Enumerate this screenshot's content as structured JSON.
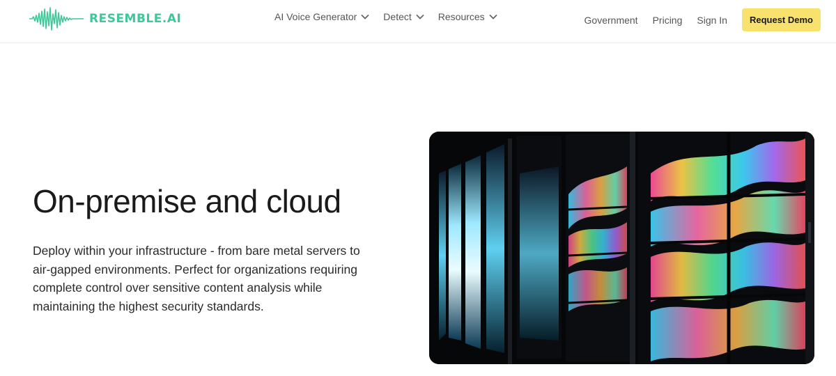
{
  "brand": {
    "name": "RESEMBLE.AI",
    "color": "#3ec79a"
  },
  "nav": {
    "menus": [
      {
        "label": "AI Voice Generator",
        "icon": "chevron-down-icon"
      },
      {
        "label": "Detect",
        "icon": "chevron-down-icon"
      },
      {
        "label": "Resources",
        "icon": "chevron-down-icon"
      }
    ],
    "links": [
      {
        "label": "Government"
      },
      {
        "label": "Pricing"
      },
      {
        "label": "Sign In"
      }
    ],
    "cta": {
      "label": "Request Demo",
      "color": "#f8e16c"
    }
  },
  "hero": {
    "title": "On-premise and cloud",
    "description": "Deploy within your infrastructure - from bare metal servers to air-gapped environments. Perfect for organizations requiring complete control over sensitive content analysis while maintaining the highest security standards."
  }
}
